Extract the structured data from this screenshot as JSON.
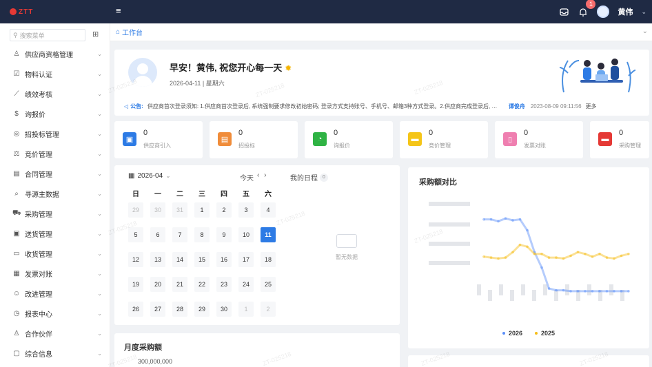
{
  "topbar": {
    "logo_text": "ZTT",
    "menu_icon": "menu-icon",
    "notification_count": "1",
    "user_name": "黄伟"
  },
  "sidebar": {
    "search_placeholder": "搜索菜单",
    "items": [
      {
        "icon": "user-icon",
        "label": "供应商资格管理"
      },
      {
        "icon": "checkbox-icon",
        "label": "物料认证"
      },
      {
        "icon": "trend-icon",
        "label": "绩效考核"
      },
      {
        "icon": "dollar-icon",
        "label": "询报价"
      },
      {
        "icon": "target-icon",
        "label": "招投标管理"
      },
      {
        "icon": "gavel-icon",
        "label": "竞价管理"
      },
      {
        "icon": "contract-icon",
        "label": "合同管理"
      },
      {
        "icon": "search-data-icon",
        "label": "寻源主数据"
      },
      {
        "icon": "cart-icon",
        "label": "采购管理"
      },
      {
        "icon": "delivery-icon",
        "label": "送货管理"
      },
      {
        "icon": "receive-icon",
        "label": "收货管理"
      },
      {
        "icon": "invoice-icon",
        "label": "发票对账"
      },
      {
        "icon": "improve-icon",
        "label": "改进管理"
      },
      {
        "icon": "report-icon",
        "label": "报表中心"
      },
      {
        "icon": "partner-icon",
        "label": "合作伙伴"
      },
      {
        "icon": "info-icon",
        "label": "综合信息"
      }
    ]
  },
  "breadcrumb": {
    "tab_label": "工作台"
  },
  "welcome": {
    "greeting": "早安！黄伟, 祝您开心每一天",
    "date": "2026-04-11 | 星期六",
    "notice_label": "公告:",
    "notice_text": "供应商首次登录须知: 1.供应商首次登录后, 系统强制要求修改初始密码; 登录方式支持账号、手机号、邮箱3种方式登录。2.供应商完成登录后, 需仔细核...",
    "notice_author": "谭俊舟",
    "notice_time": "2023-08-09 09:11:56",
    "notice_more": "更多"
  },
  "tiles": [
    {
      "value": "0",
      "label": "供应商引入",
      "color": "#2d7be5",
      "icon": "user-card-icon"
    },
    {
      "value": "0",
      "label": "招投标",
      "color": "#f08c3a",
      "icon": "bid-icon"
    },
    {
      "value": "0",
      "label": "询报价",
      "color": "#2fb344",
      "icon": "pie-icon"
    },
    {
      "value": "0",
      "label": "竞价管理",
      "color": "#f5c518",
      "icon": "chat-icon"
    },
    {
      "value": "0",
      "label": "发票对账",
      "color": "#ef7fb0",
      "icon": "doc-icon"
    },
    {
      "value": "0",
      "label": "采购管理",
      "color": "#e53935",
      "icon": "message-icon"
    }
  ],
  "calendar": {
    "month": "2026-04",
    "today_btn": "今天",
    "schedule_label": "我的日程",
    "schedule_count": "0",
    "weekdays": [
      "日",
      "一",
      "二",
      "三",
      "四",
      "五",
      "六"
    ],
    "weeks": [
      [
        "29",
        "30",
        "31",
        "1",
        "2",
        "3",
        "4"
      ],
      [
        "5",
        "6",
        "7",
        "8",
        "9",
        "10",
        "11"
      ],
      [
        "12",
        "13",
        "14",
        "15",
        "16",
        "17",
        "18"
      ],
      [
        "19",
        "20",
        "21",
        "22",
        "23",
        "24",
        "25"
      ],
      [
        "26",
        "27",
        "28",
        "29",
        "30",
        "1",
        "2"
      ]
    ],
    "other_month_cells": [
      [
        0,
        0
      ],
      [
        0,
        1
      ],
      [
        0,
        2
      ],
      [
        4,
        5
      ],
      [
        4,
        6
      ]
    ],
    "today_cell": [
      1,
      6
    ],
    "empty_text": "暂无数据"
  },
  "monthly": {
    "title": "月度采购额",
    "y_top_label": "300,000,000"
  },
  "compare": {
    "title": "采购额对比"
  },
  "chart_data": {
    "type": "line",
    "title": "采购额对比",
    "series": [
      {
        "name": "2026",
        "color": "#5b8ff9",
        "values": [
          0.98,
          0.98,
          0.96,
          0.99,
          0.97,
          0.98,
          0.86,
          0.62,
          0.45,
          0.22,
          0.2,
          0.2,
          0.19,
          0.19,
          0.19,
          0.19,
          0.19,
          0.19,
          0.19,
          0.19,
          0.19
        ]
      },
      {
        "name": "2025",
        "color": "#f6bd16",
        "values": [
          0.57,
          0.56,
          0.55,
          0.56,
          0.62,
          0.7,
          0.68,
          0.6,
          0.6,
          0.56,
          0.56,
          0.55,
          0.58,
          0.62,
          0.6,
          0.57,
          0.6,
          0.56,
          0.55,
          0.58,
          0.6
        ]
      }
    ],
    "legend_position": "bottom"
  },
  "watermark": "ZT-025218"
}
